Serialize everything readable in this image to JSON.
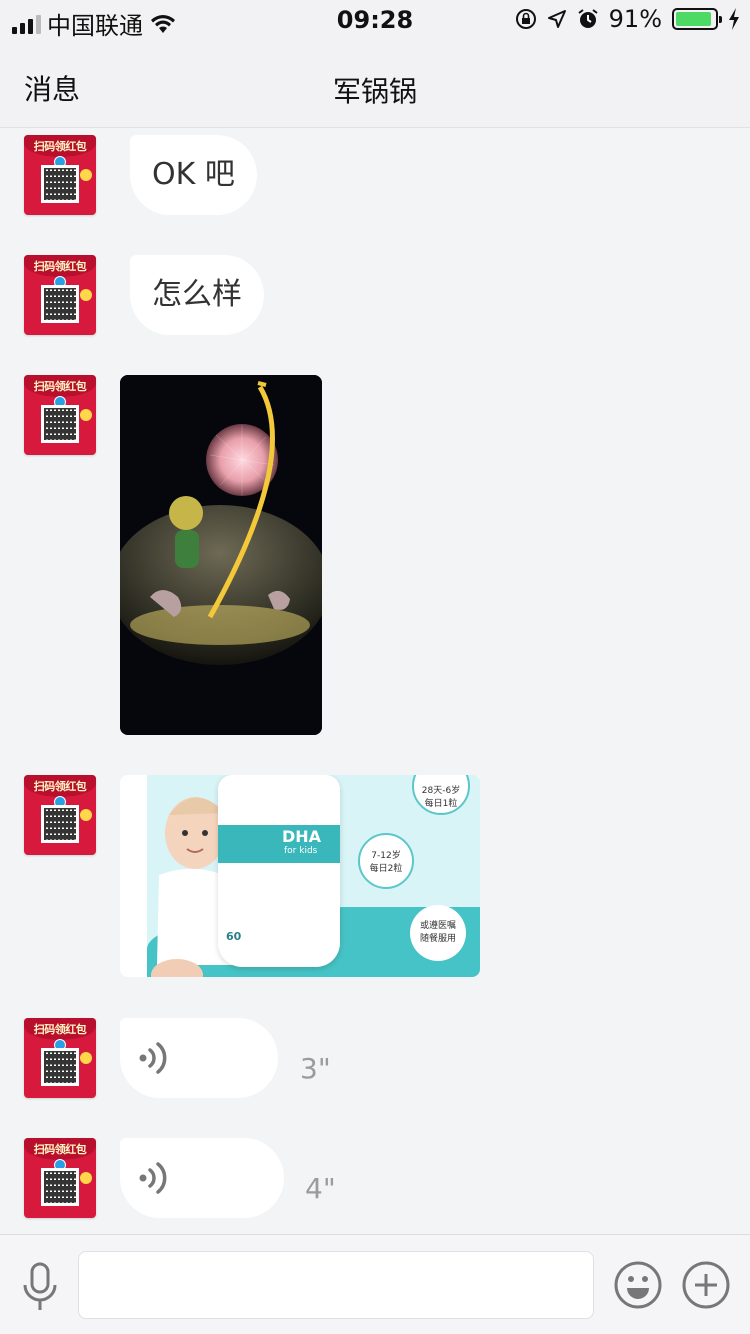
{
  "status_bar": {
    "carrier": "中国联通",
    "time": "09:28",
    "battery_text": "91%",
    "battery_level": 0.91,
    "battery_color": "#4cd964"
  },
  "nav": {
    "back_label": "消息",
    "title": "军锅锅"
  },
  "avatar": {
    "text": "扫码领红包",
    "color": "#d7193d"
  },
  "messages": [
    {
      "type": "text",
      "text": "OK 吧"
    },
    {
      "type": "text",
      "text": "怎么样"
    },
    {
      "type": "image",
      "subject": "night-lamp-photo"
    },
    {
      "type": "image",
      "subject": "dha-product-ad",
      "label_brand": "DHA",
      "label_sub": "for kids",
      "label_caps": "60",
      "bubble_1": "28天-6岁",
      "bubble_1b": "每日1粒",
      "bubble_2": "7-12岁",
      "bubble_2b": "每日2粒",
      "bubble_3": "或遵医嘱",
      "bubble_3b": "随餐服用"
    },
    {
      "type": "voice",
      "duration": "3\""
    },
    {
      "type": "voice",
      "duration": "4\""
    }
  ],
  "input_bar": {
    "placeholder": "",
    "value": ""
  },
  "icons": {
    "mic": "microphone-icon",
    "emoji": "emoji-icon",
    "plus": "plus-circle-icon",
    "wifi": "wifi-icon",
    "location": "location-arrow-icon",
    "alarm": "alarm-icon",
    "rotation_lock": "rotation-lock-icon",
    "charging": "charging-bolt-icon"
  }
}
